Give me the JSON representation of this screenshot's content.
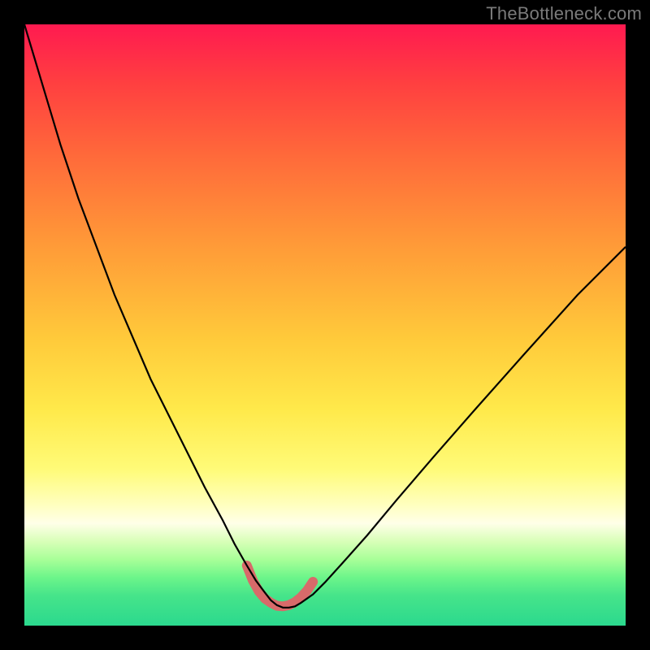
{
  "watermark": {
    "text": "TheBottleneck.com"
  },
  "chart_data": {
    "type": "line",
    "title": "",
    "xlabel": "",
    "ylabel": "",
    "xlim": [
      0,
      100
    ],
    "ylim": [
      0,
      100
    ],
    "grid": false,
    "legend": false,
    "series": [
      {
        "name": "bottleneck-curve",
        "x": [
          0,
          3,
          6,
          9,
          12,
          15,
          18,
          21,
          24,
          27,
          30,
          33,
          35,
          37,
          38.5,
          40,
          41,
          42,
          43,
          44,
          45,
          46,
          48,
          50,
          53,
          57,
          62,
          68,
          75,
          83,
          92,
          100
        ],
        "y": [
          100,
          90,
          80,
          71,
          63,
          55,
          48,
          41,
          35,
          29,
          23,
          17.5,
          13.5,
          10,
          7.5,
          5.5,
          4.2,
          3.4,
          3.0,
          3.0,
          3.2,
          3.8,
          5.2,
          7.2,
          10.5,
          15,
          21,
          28,
          36,
          45,
          55,
          63
        ]
      },
      {
        "name": "optimal-zone-marker",
        "x": [
          37,
          38,
          39,
          40,
          41,
          42,
          43,
          44,
          45,
          46,
          47,
          48
        ],
        "y": [
          10,
          7.5,
          5.7,
          4.5,
          3.8,
          3.3,
          3.2,
          3.4,
          3.9,
          4.7,
          5.8,
          7.3
        ]
      }
    ],
    "styles": {
      "bottleneck-curve": {
        "stroke": "#000000",
        "width": 2.2
      },
      "optimal-zone-marker": {
        "stroke": "#d86a6a",
        "width": 12,
        "linecap": "round"
      }
    }
  }
}
